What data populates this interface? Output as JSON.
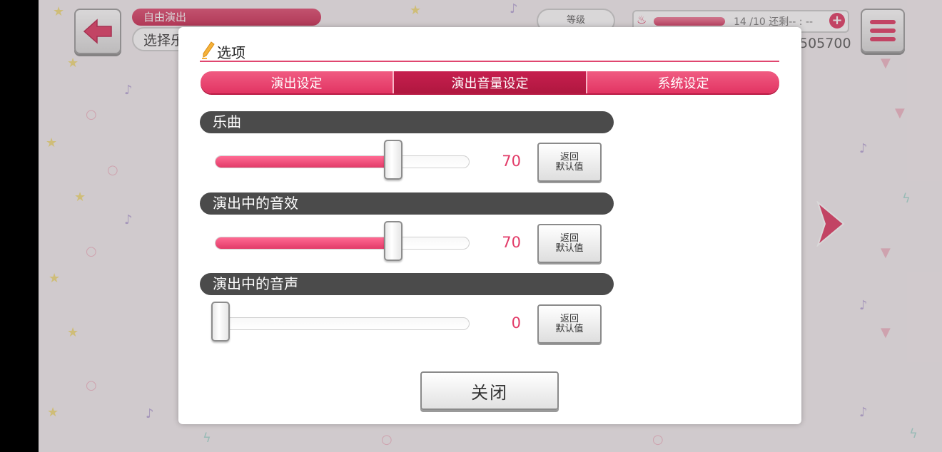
{
  "header": {
    "mode_label": "自由演出",
    "song_select_label": "选择乐",
    "level_label": "等级",
    "stamina_text": "14 /10  还剩-- : --",
    "score_text": "505700"
  },
  "dialog": {
    "title": "选项",
    "tabs": [
      {
        "label": "演出设定",
        "active": false
      },
      {
        "label": "演出音量设定",
        "active": true
      },
      {
        "label": "系统设定",
        "active": false
      }
    ],
    "sections": [
      {
        "label": "乐曲",
        "value": 70,
        "max": 100,
        "reset_label": "返回\n默认值"
      },
      {
        "label": "演出中的音效",
        "value": 70,
        "max": 100,
        "reset_label": "返回\n默认值"
      },
      {
        "label": "演出中的音声",
        "value": 0,
        "max": 100,
        "reset_label": "返回\n默认值"
      }
    ],
    "close_label": "关闭"
  },
  "colors": {
    "accent": "#e23b68",
    "tab_active": "#b8194a",
    "section_header": "#4b4b4b"
  }
}
